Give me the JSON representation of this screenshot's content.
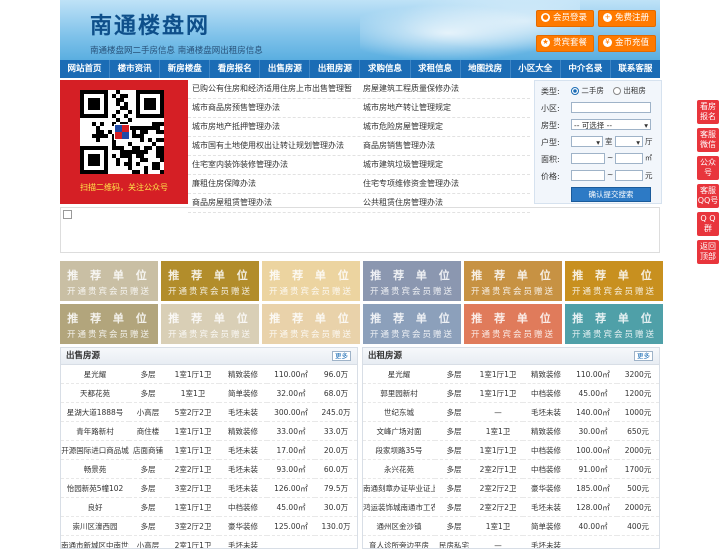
{
  "header": {
    "site_title": "南通楼盘网",
    "site_subtitle": "南通楼盘网二手房信息   南通楼盘网出租房信息",
    "buttons": [
      "会员登录",
      "免费注册",
      "贵宾套餐",
      "金币充值"
    ]
  },
  "nav": [
    "网站首页",
    "楼市资讯",
    "新房楼盘",
    "看房报名",
    "出售房源",
    "出租房源",
    "求购信息",
    "求租信息",
    "地图找房",
    "小区大全",
    "中介名录",
    "联系客服"
  ],
  "qr": {
    "caption": "扫描二维码，关注公众号"
  },
  "links": [
    [
      "已购公有住房和经济适用住房上市出售管理暂",
      "房屋建筑工程质量保修办法"
    ],
    [
      "城市商品房预售管理办法",
      "城市房地产转让管理规定"
    ],
    [
      "城市房地产抵押管理办法",
      "城市危险房屋管理规定"
    ],
    [
      "城市国有土地使用权出让转让规划管理办法",
      "商品房销售管理办法"
    ],
    [
      "住宅室内装饰装修管理办法",
      "城市建筑垃圾管理规定"
    ],
    [
      "廉租住房保障办法",
      "住宅专项维修资金管理办法"
    ],
    [
      "商品房屋租赁管理办法",
      "公共租赁住房管理办法"
    ]
  ],
  "search": {
    "type_label": "类型:",
    "type_options": [
      "二手房",
      "出租房"
    ],
    "community_label": "小区:",
    "housetype_label": "房型:",
    "housetype_value": "-- 可选择 --",
    "layout_label": "户型:",
    "room_unit": "室",
    "hall_unit": "厅",
    "area_label": "面积:",
    "area_sep": "~",
    "area_unit": "㎡",
    "price_label": "价格:",
    "price_sep": "~",
    "price_unit": "元",
    "submit": "确认提交搜索"
  },
  "tiles": {
    "title": "推 荐 单 位",
    "sub": "开通贵宾会员赠送",
    "colors": [
      "#c9bfa4",
      "#b28d2b",
      "#ecd4a0",
      "#8b97b0",
      "#c79243",
      "#c8901f",
      "#b2a57c",
      "#d9cfb6",
      "#e9d2aa",
      "#8ca0bb",
      "#e07b5b",
      "#4fa0a8"
    ]
  },
  "sale": {
    "title": "出售房源",
    "more": "更多",
    "rows": [
      [
        "星光耀",
        "多层",
        "1室1厅1卫",
        "精致装修",
        "110.00㎡",
        "96.0万"
      ],
      [
        "天都花苑",
        "多层",
        "1室1卫",
        "简单装修",
        "32.00㎡",
        "68.0万"
      ],
      [
        "星湖大道1888号",
        "小高层",
        "5室2厅2卫",
        "毛坯未装",
        "300.00㎡",
        "245.0万"
      ],
      [
        "青年路新村",
        "商住楼",
        "1室1厅1卫",
        "精致装修",
        "33.00㎡",
        "33.0万"
      ],
      [
        "开源国际进口商品城",
        "店面商铺",
        "1室1厅1卫",
        "毛坯未装",
        "17.00㎡",
        "20.0万"
      ],
      [
        "畅景苑",
        "多层",
        "2室2厅1卫",
        "毛坯未装",
        "93.00㎡",
        "60.0万"
      ],
      [
        "怡园新苑5幢102",
        "多层",
        "3室2厅1卫",
        "毛坯未装",
        "126.00㎡",
        "79.5万"
      ],
      [
        "良好",
        "多层",
        "1室1厅1卫",
        "中档装修",
        "45.00㎡",
        "30.0万"
      ],
      [
        "崇川区濠西园",
        "多层",
        "3室2厅2卫",
        "豪华装修",
        "125.00㎡",
        "130.0万"
      ],
      [
        "南通市新城区中南世纪",
        "小高层",
        "2室1厅1卫",
        "毛坯未装",
        "",
        ""
      ]
    ]
  },
  "rent": {
    "title": "出租房源",
    "more": "更多",
    "rows": [
      [
        "星光耀",
        "多层",
        "1室1厅1卫",
        "精致装修",
        "110.00㎡",
        "3200元"
      ],
      [
        "郭里园新村",
        "多层",
        "1室1厅1卫",
        "中档装修",
        "45.00㎡",
        "1200元"
      ],
      [
        "世纪东城",
        "多层",
        "—",
        "毛坯未装",
        "140.00㎡",
        "1000元"
      ],
      [
        "文峰广场对面",
        "多层",
        "1室1卫",
        "精致装修",
        "30.00㎡",
        "650元"
      ],
      [
        "段家坝路35号",
        "多层",
        "1室1厅1卫",
        "中档装修",
        "100.00㎡",
        "2000元"
      ],
      [
        "永兴花苑",
        "多层",
        "2室2厅1卫",
        "中档装修",
        "91.00㎡",
        "1700元"
      ],
      [
        "南通刻章办证毕业证上",
        "多层",
        "2室2厅2卫",
        "豪华装修",
        "185.00㎡",
        "500元"
      ],
      [
        "鸿运装饰城南通市工农",
        "多层",
        "2室2厅2卫",
        "毛坯未装",
        "128.00㎡",
        "2000元"
      ],
      [
        "通州区金沙镇",
        "多层",
        "1室1卫",
        "简单装修",
        "40.00㎡",
        "400元"
      ],
      [
        "育人诊所旁边平房",
        "民房私宅",
        "—",
        "毛坯未装",
        "",
        ""
      ]
    ]
  },
  "floaters": [
    "看房\n报名",
    "客服\n微信",
    "公众\n号",
    "客服\nQQ号",
    "Q Q\n群",
    "返回\n顶部"
  ]
}
